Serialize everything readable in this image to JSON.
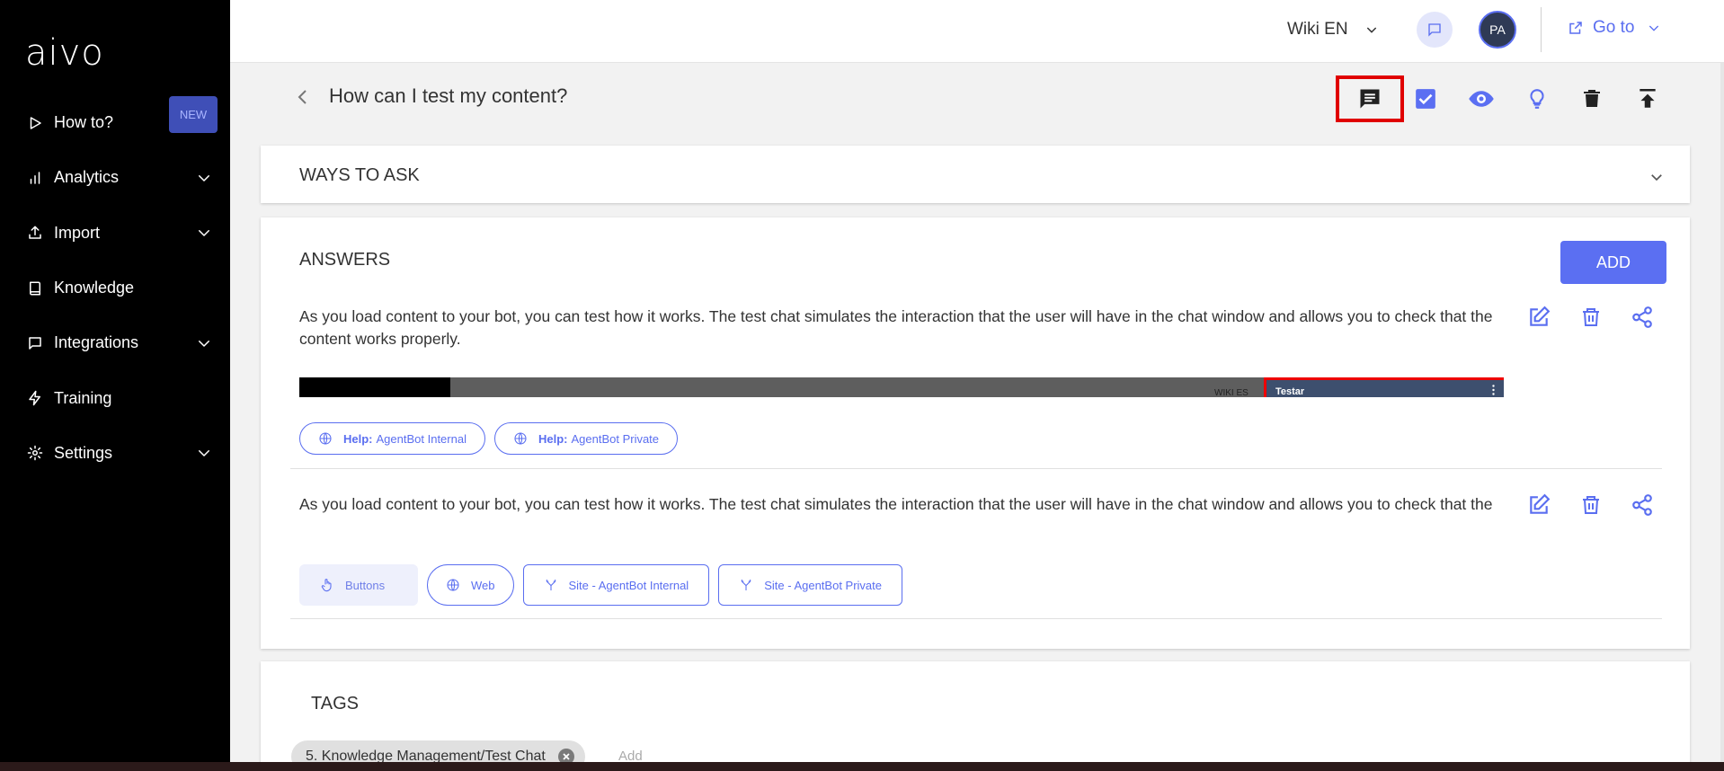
{
  "brand": {
    "logo": "aivo"
  },
  "sidebar": {
    "items": [
      {
        "label": "How to?",
        "badge": "NEW",
        "icon": "play-icon",
        "has_chevron": false
      },
      {
        "label": "Analytics",
        "icon": "bar-chart-icon",
        "has_chevron": true
      },
      {
        "label": "Import",
        "icon": "upload-icon",
        "has_chevron": true
      },
      {
        "label": "Knowledge",
        "icon": "book-icon",
        "has_chevron": false
      },
      {
        "label": "Integrations",
        "icon": "chat-bubble-icon",
        "has_chevron": true
      },
      {
        "label": "Training",
        "icon": "bolt-icon",
        "has_chevron": false
      },
      {
        "label": "Settings",
        "icon": "gear-icon",
        "has_chevron": true
      }
    ]
  },
  "topbar": {
    "language": "Wiki EN",
    "avatar_initials": "PA",
    "goto_label": "Go to"
  },
  "title_bar": {
    "title": "How can I test my content?",
    "actions": [
      "comment-icon",
      "checkbox-icon",
      "eye-icon",
      "lightbulb-icon",
      "trash-icon",
      "publish-icon"
    ]
  },
  "ways_to_ask": {
    "title": "WAYS TO ASK"
  },
  "answers": {
    "title": "ANSWERS",
    "add_label": "ADD",
    "items": [
      {
        "text": "As you load content to your bot, you can test how it works. The test chat simulates the interaction that the user will have in the chat window and allows you to check that the content works properly.",
        "preview_small_text": "WIKI ES",
        "preview_window_title": "Testar",
        "chips": [
          {
            "bold": "Help:",
            "text": "AgentBot Internal"
          },
          {
            "bold": "Help:",
            "text": "AgentBot Private"
          }
        ]
      },
      {
        "text": "As you load content to your bot, you can test how it works. The test chat simulates the interaction that the user will have in the chat window and allows you to check that the content works properly. See the following article for more information:",
        "chips": [
          {
            "text": "Buttons",
            "icon": "hand-pointer-icon"
          },
          {
            "text": "Web",
            "icon": "globe-icon"
          },
          {
            "text": "Site - AgentBot Internal",
            "icon": "fork-icon"
          },
          {
            "text": "Site - AgentBot Private",
            "icon": "fork-icon"
          }
        ]
      }
    ]
  },
  "tags": {
    "title": "TAGS",
    "items": [
      "5. Knowledge Management/Test Chat"
    ],
    "add_placeholder": "Add"
  },
  "colors": {
    "accent": "#5b6ff2",
    "sidebar_bg": "#000000",
    "highlight": "#e00000"
  }
}
